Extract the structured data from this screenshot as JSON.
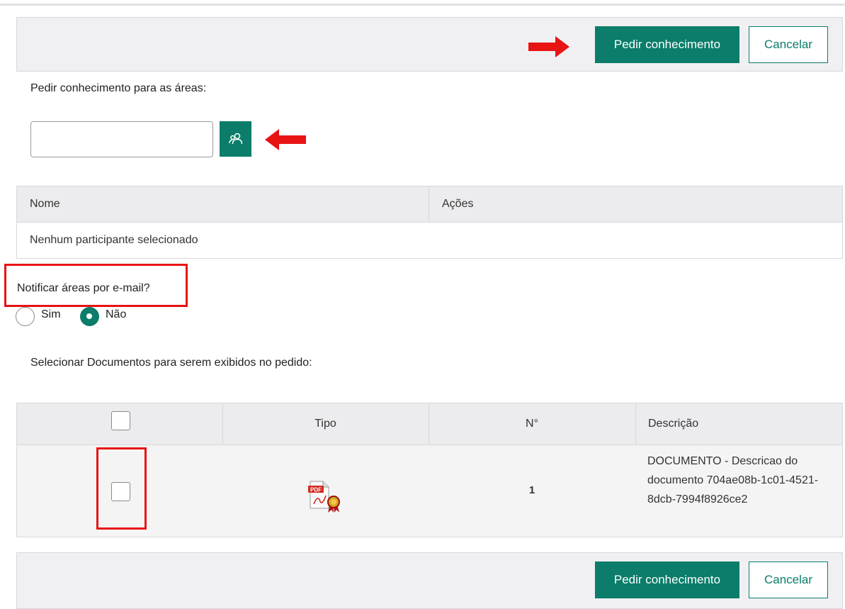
{
  "colors": {
    "accent": "#0b7d6a",
    "highlight_red": "#e81313",
    "bar_bg": "#f0f0f2"
  },
  "top_bar": {
    "request_button": "Pedir conhecimento",
    "cancel_button": "Cancelar"
  },
  "areas": {
    "label": "Pedir conhecimento para as áreas:",
    "input_value": "",
    "search_icon": "users-icon"
  },
  "participants_table": {
    "columns": [
      "Nome",
      "Ações"
    ],
    "empty_message": "Nenhum participante selecionado"
  },
  "notify": {
    "label": "Notificar áreas por e-mail?",
    "options": [
      "Sim",
      "Não"
    ],
    "selected": "Não"
  },
  "documents": {
    "label": "Selecionar Documentos para serem exibidos no pedido:",
    "columns": [
      "",
      "Tipo",
      "N°",
      "Descrição"
    ],
    "rows": [
      {
        "checked": false,
        "type_icon": "pdf-signed-icon",
        "number": "1",
        "description": "DOCUMENTO - Descricao do documento 704ae08b-1c01-4521-8dcb-7994f8926ce2"
      }
    ]
  },
  "bottom_bar": {
    "request_button": "Pedir conhecimento",
    "cancel_button": "Cancelar"
  }
}
